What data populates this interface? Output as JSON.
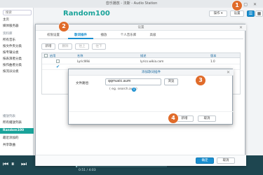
{
  "window": {
    "title": "音乐播放 - 法斯 - Audio Station",
    "controls": "— ▢ ✕"
  },
  "sidebar": {
    "search_placeholder": "搜索",
    "items": [
      {
        "label": "主页"
      },
      {
        "label": "媒体服务器"
      },
      {
        "label": "所有音乐"
      },
      {
        "label": "按文件夹分类"
      },
      {
        "label": "按专辑分类"
      },
      {
        "label": "按表演者分类"
      },
      {
        "label": "按作曲者分类"
      },
      {
        "label": "按流派分类"
      },
      {
        "label": "所有播放列表"
      },
      {
        "label": "Random100"
      },
      {
        "label": "最近添加的"
      },
      {
        "label": "共享歌曲"
      }
    ],
    "groups": [
      "资料库",
      "播放列表"
    ]
  },
  "main": {
    "title": "Random100",
    "buttons": {
      "action": "操作 ▾",
      "settings": "设置"
    }
  },
  "player": {
    "time": "0:51 / 4:03"
  },
  "settings_dialog": {
    "title": "设置",
    "tabs": [
      "权限设置",
      "歌词插件",
      "播放",
      "个人音乐库",
      "高级"
    ],
    "active_tab": 1,
    "toolbar": {
      "add": "新增",
      "delete": "删除",
      "up": "往上",
      "down": "往下"
    },
    "columns": [
      "启用",
      "名称",
      "描述",
      "版本"
    ],
    "rows": [
      {
        "enabled": false,
        "name": "LyricWiki",
        "desc": "lyrics.wikia.com",
        "version": "1.0"
      },
      {
        "enabled": true,
        "name": "",
        "desc": "",
        "version": ""
      }
    ],
    "footer": {
      "ok": "确定",
      "cancel": "取消"
    }
  },
  "add_plugin_modal": {
    "title": "添加歌词插件",
    "field_label": "文件路径:",
    "field_value": "qqmusic.aum",
    "browse": "浏览",
    "hint": "( eg. search.aum)",
    "buttons": {
      "add": "新增",
      "cancel": "取消"
    }
  },
  "markers": [
    "1",
    "2",
    "3",
    "4"
  ],
  "colors": {
    "accent": "#1aa39a",
    "primary_button": "#1a8fd0",
    "marker": "#e06b2a",
    "player_bg": "#1e4650"
  }
}
